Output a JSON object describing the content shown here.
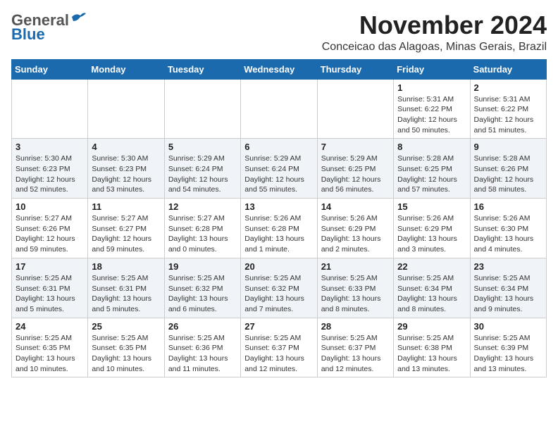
{
  "header": {
    "logo_general": "General",
    "logo_blue": "Blue",
    "month_title": "November 2024",
    "location": "Conceicao das Alagoas, Minas Gerais, Brazil"
  },
  "calendar": {
    "weekdays": [
      "Sunday",
      "Monday",
      "Tuesday",
      "Wednesday",
      "Thursday",
      "Friday",
      "Saturday"
    ],
    "weeks": [
      [
        {
          "day": "",
          "info": ""
        },
        {
          "day": "",
          "info": ""
        },
        {
          "day": "",
          "info": ""
        },
        {
          "day": "",
          "info": ""
        },
        {
          "day": "",
          "info": ""
        },
        {
          "day": "1",
          "info": "Sunrise: 5:31 AM\nSunset: 6:22 PM\nDaylight: 12 hours and 50 minutes."
        },
        {
          "day": "2",
          "info": "Sunrise: 5:31 AM\nSunset: 6:22 PM\nDaylight: 12 hours and 51 minutes."
        }
      ],
      [
        {
          "day": "3",
          "info": "Sunrise: 5:30 AM\nSunset: 6:23 PM\nDaylight: 12 hours and 52 minutes."
        },
        {
          "day": "4",
          "info": "Sunrise: 5:30 AM\nSunset: 6:23 PM\nDaylight: 12 hours and 53 minutes."
        },
        {
          "day": "5",
          "info": "Sunrise: 5:29 AM\nSunset: 6:24 PM\nDaylight: 12 hours and 54 minutes."
        },
        {
          "day": "6",
          "info": "Sunrise: 5:29 AM\nSunset: 6:24 PM\nDaylight: 12 hours and 55 minutes."
        },
        {
          "day": "7",
          "info": "Sunrise: 5:29 AM\nSunset: 6:25 PM\nDaylight: 12 hours and 56 minutes."
        },
        {
          "day": "8",
          "info": "Sunrise: 5:28 AM\nSunset: 6:25 PM\nDaylight: 12 hours and 57 minutes."
        },
        {
          "day": "9",
          "info": "Sunrise: 5:28 AM\nSunset: 6:26 PM\nDaylight: 12 hours and 58 minutes."
        }
      ],
      [
        {
          "day": "10",
          "info": "Sunrise: 5:27 AM\nSunset: 6:26 PM\nDaylight: 12 hours and 59 minutes."
        },
        {
          "day": "11",
          "info": "Sunrise: 5:27 AM\nSunset: 6:27 PM\nDaylight: 12 hours and 59 minutes."
        },
        {
          "day": "12",
          "info": "Sunrise: 5:27 AM\nSunset: 6:28 PM\nDaylight: 13 hours and 0 minutes."
        },
        {
          "day": "13",
          "info": "Sunrise: 5:26 AM\nSunset: 6:28 PM\nDaylight: 13 hours and 1 minute."
        },
        {
          "day": "14",
          "info": "Sunrise: 5:26 AM\nSunset: 6:29 PM\nDaylight: 13 hours and 2 minutes."
        },
        {
          "day": "15",
          "info": "Sunrise: 5:26 AM\nSunset: 6:29 PM\nDaylight: 13 hours and 3 minutes."
        },
        {
          "day": "16",
          "info": "Sunrise: 5:26 AM\nSunset: 6:30 PM\nDaylight: 13 hours and 4 minutes."
        }
      ],
      [
        {
          "day": "17",
          "info": "Sunrise: 5:25 AM\nSunset: 6:31 PM\nDaylight: 13 hours and 5 minutes."
        },
        {
          "day": "18",
          "info": "Sunrise: 5:25 AM\nSunset: 6:31 PM\nDaylight: 13 hours and 5 minutes."
        },
        {
          "day": "19",
          "info": "Sunrise: 5:25 AM\nSunset: 6:32 PM\nDaylight: 13 hours and 6 minutes."
        },
        {
          "day": "20",
          "info": "Sunrise: 5:25 AM\nSunset: 6:32 PM\nDaylight: 13 hours and 7 minutes."
        },
        {
          "day": "21",
          "info": "Sunrise: 5:25 AM\nSunset: 6:33 PM\nDaylight: 13 hours and 8 minutes."
        },
        {
          "day": "22",
          "info": "Sunrise: 5:25 AM\nSunset: 6:34 PM\nDaylight: 13 hours and 8 minutes."
        },
        {
          "day": "23",
          "info": "Sunrise: 5:25 AM\nSunset: 6:34 PM\nDaylight: 13 hours and 9 minutes."
        }
      ],
      [
        {
          "day": "24",
          "info": "Sunrise: 5:25 AM\nSunset: 6:35 PM\nDaylight: 13 hours and 10 minutes."
        },
        {
          "day": "25",
          "info": "Sunrise: 5:25 AM\nSunset: 6:35 PM\nDaylight: 13 hours and 10 minutes."
        },
        {
          "day": "26",
          "info": "Sunrise: 5:25 AM\nSunset: 6:36 PM\nDaylight: 13 hours and 11 minutes."
        },
        {
          "day": "27",
          "info": "Sunrise: 5:25 AM\nSunset: 6:37 PM\nDaylight: 13 hours and 12 minutes."
        },
        {
          "day": "28",
          "info": "Sunrise: 5:25 AM\nSunset: 6:37 PM\nDaylight: 13 hours and 12 minutes."
        },
        {
          "day": "29",
          "info": "Sunrise: 5:25 AM\nSunset: 6:38 PM\nDaylight: 13 hours and 13 minutes."
        },
        {
          "day": "30",
          "info": "Sunrise: 5:25 AM\nSunset: 6:39 PM\nDaylight: 13 hours and 13 minutes."
        }
      ]
    ]
  }
}
